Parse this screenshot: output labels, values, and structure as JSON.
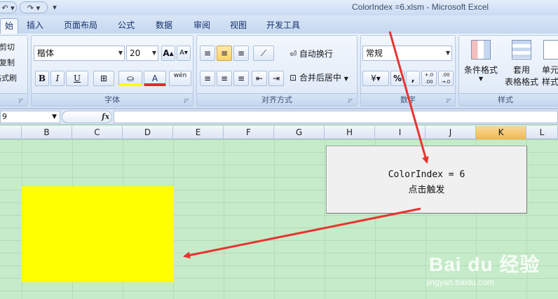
{
  "window": {
    "title": "ColorIndex =6.xlsm - Microsoft Excel",
    "qat_undo": "↶ ▾",
    "qat_redo": "↷ ▾",
    "qat_more": "▾"
  },
  "tabs": [
    {
      "label": "始",
      "active": true
    },
    {
      "label": "插入"
    },
    {
      "label": "页面布局"
    },
    {
      "label": "公式"
    },
    {
      "label": "数据"
    },
    {
      "label": "审阅"
    },
    {
      "label": "视图"
    },
    {
      "label": "开发工具"
    }
  ],
  "clipboard": {
    "cut": "剪切",
    "copy": "复制",
    "format_painter": "格式刷"
  },
  "font": {
    "name": "楷体",
    "size": "20",
    "grow": "A▴",
    "shrink": "A▾",
    "bold": "B",
    "italic": "I",
    "underline": "U",
    "border": "⊞",
    "fill_color": "A",
    "font_color": "A",
    "phonetic": "wén",
    "group_label": "字体"
  },
  "alignment": {
    "wrap_text": "自动换行",
    "merge_center": "合并后居中",
    "group_label": "对齐方式"
  },
  "number": {
    "format": "常规",
    "percent": "%",
    "comma": ",",
    "inc_decimal": "+.0 .00",
    "dec_decimal": ".00 →.0",
    "group_label": "数字"
  },
  "styles": {
    "conditional_format": "条件格式",
    "table_format_1": "套用",
    "table_format_2": "表格格式",
    "cell_styles_1": "单元",
    "cell_styles_2": "样式",
    "group_label": "样式"
  },
  "formula_bar": {
    "name_box": "9",
    "fx": "fx",
    "formula": ""
  },
  "columns": [
    "B",
    "C",
    "D",
    "E",
    "F",
    "G",
    "H",
    "I",
    "J",
    "K",
    "L"
  ],
  "selected_column": "K",
  "macro_button": {
    "line1": "ColorIndex = 6",
    "line2": "点击触发"
  },
  "highlight_color": "#ffff00",
  "arrow_color": "#e8332f",
  "watermark": {
    "brand": "Bai du 经验",
    "url": "jingyan.baidu.com"
  }
}
